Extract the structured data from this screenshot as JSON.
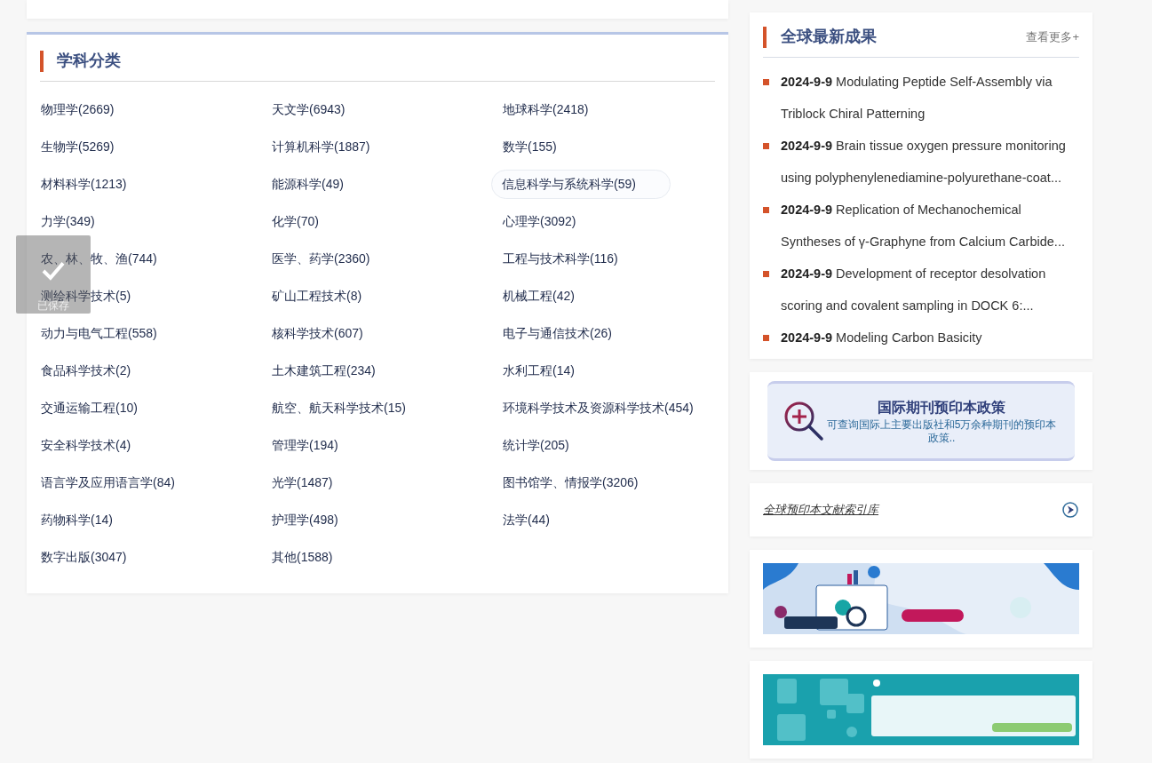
{
  "categories": {
    "title": "学科分类",
    "items": [
      {
        "label": "物理学(2669)",
        "highlighted": false
      },
      {
        "label": "天文学(6943)",
        "highlighted": false
      },
      {
        "label": "地球科学(2418)",
        "highlighted": false
      },
      {
        "label": "生物学(5269)",
        "highlighted": false
      },
      {
        "label": "计算机科学(1887)",
        "highlighted": false
      },
      {
        "label": "数学(155)",
        "highlighted": false
      },
      {
        "label": "材料科学(1213)",
        "highlighted": false
      },
      {
        "label": "能源科学(49)",
        "highlighted": false
      },
      {
        "label": "信息科学与系统科学(59)",
        "highlighted": true
      },
      {
        "label": "力学(349)",
        "highlighted": false
      },
      {
        "label": "化学(70)",
        "highlighted": false
      },
      {
        "label": "心理学(3092)",
        "highlighted": false
      },
      {
        "label": "农、林、牧、渔(744)",
        "highlighted": false
      },
      {
        "label": "医学、药学(2360)",
        "highlighted": false
      },
      {
        "label": "工程与技术科学(116)",
        "highlighted": false
      },
      {
        "label": "测绘科学技术(5)",
        "highlighted": false
      },
      {
        "label": "矿山工程技术(8)",
        "highlighted": false
      },
      {
        "label": "机械工程(42)",
        "highlighted": false
      },
      {
        "label": "动力与电气工程(558)",
        "highlighted": false
      },
      {
        "label": "核科学技术(607)",
        "highlighted": false
      },
      {
        "label": "电子与通信技术(26)",
        "highlighted": false
      },
      {
        "label": "食品科学技术(2)",
        "highlighted": false
      },
      {
        "label": "土木建筑工程(234)",
        "highlighted": false
      },
      {
        "label": "水利工程(14)",
        "highlighted": false
      },
      {
        "label": "交通运输工程(10)",
        "highlighted": false
      },
      {
        "label": "航空、航天科学技术(15)",
        "highlighted": false
      },
      {
        "label": "环境科学技术及资源科学技术(454)",
        "highlighted": false
      },
      {
        "label": "安全科学技术(4)",
        "highlighted": false
      },
      {
        "label": "管理学(194)",
        "highlighted": false
      },
      {
        "label": "统计学(205)",
        "highlighted": false
      },
      {
        "label": "语言学及应用语言学(84)",
        "highlighted": false
      },
      {
        "label": "光学(1487)",
        "highlighted": false
      },
      {
        "label": "图书馆学、情报学(3206)",
        "highlighted": false
      },
      {
        "label": "药物科学(14)",
        "highlighted": false
      },
      {
        "label": "护理学(498)",
        "highlighted": false
      },
      {
        "label": "法学(44)",
        "highlighted": false
      },
      {
        "label": "数字出版(3047)",
        "highlighted": false
      },
      {
        "label": "其他(1588)",
        "highlighted": false
      }
    ]
  },
  "toast": {
    "label": "已保存"
  },
  "latest": {
    "title": "全球最新成果",
    "more": "查看更多+",
    "items": [
      {
        "date": "2024-9-9",
        "title": "Modulating Peptide Self-Assembly via Triblock Chiral Patterning"
      },
      {
        "date": "2024-9-9",
        "title": "Brain tissue oxygen pressure monitoring using polyphenylenediamine-polyurethane-coat..."
      },
      {
        "date": "2024-9-9",
        "title": "Replication of Mechanochemical Syntheses of γ-Graphyne from Calcium Carbide..."
      },
      {
        "date": "2024-9-9",
        "title": "Development of receptor desolvation scoring and covalent sampling in DOCK 6:..."
      },
      {
        "date": "2024-9-9",
        "title": "Modeling Carbon Basicity"
      }
    ]
  },
  "policy": {
    "title": "国际期刊预印本政策",
    "description": "可查询国际上主要出版社和5万余种期刊的预印本政策.."
  },
  "index_link": {
    "label": "全球预印本文献索引库"
  }
}
